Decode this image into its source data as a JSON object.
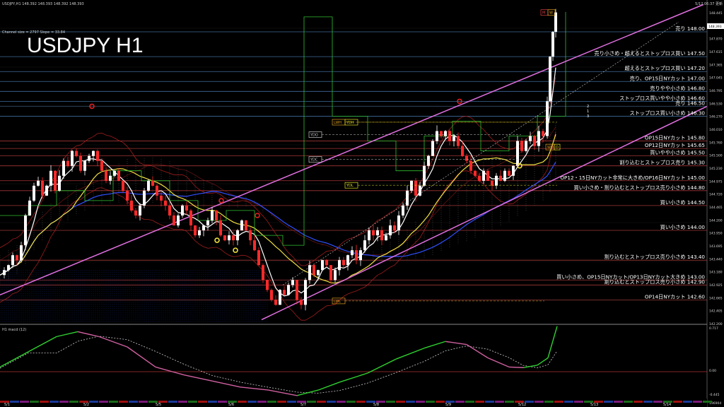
{
  "window": {
    "symbol_header": "USDJPY,H1  148.392 148.393 148.392 148.393",
    "time_header": "5/12 06:37 更新",
    "channel_info": "Channel size = 2797 Slope = 33.84",
    "big_title": "USDJPY H1",
    "macd_label": "H1 macd (12)"
  },
  "colors": {
    "bull": "#ffffff",
    "bear": "#ff2a2a",
    "channel": "#e070e0",
    "ma_fast": "#ffffff",
    "ma_mid": "#f0e040",
    "ma_slow": "#3050ff",
    "band": "#b02020",
    "green": "#30c030",
    "level_blue": "#4a7fb5",
    "level_red": "#c04040"
  },
  "price_axis": [
    "148.445",
    "148.180",
    "147.870",
    "147.615",
    "147.365",
    "147.045",
    "146.795",
    "146.530",
    "146.270",
    "146.010",
    "145.760",
    "145.500",
    "145.230",
    "144.975",
    "144.720",
    "144.465",
    "144.200",
    "143.950",
    "143.695",
    "143.440",
    "143.180",
    "142.925",
    "142.665",
    "142.405",
    "142.200"
  ],
  "price_tag": "148.393",
  "macd_axis": [
    "0.717",
    "0.00",
    "-0.445",
    "196904"
  ],
  "date_axis": [
    "5/1",
    "5/2",
    "5/5",
    "5/6",
    "5/7",
    "5/8",
    "5/9",
    "5/12",
    "5/13",
    "5/14"
  ],
  "levels": [
    {
      "text": "売り 148.00",
      "price": 148.0,
      "color": "#4a7fb5"
    },
    {
      "text": "売り小さめ・超えるとストップロス買い 147.50",
      "price": 147.5,
      "color": "#4a7fb5"
    },
    {
      "text": "超えるとストップロス買い 147.20",
      "price": 147.2,
      "color": "#4a7fb5"
    },
    {
      "text": "売り、OP15日NYカット 147.00",
      "price": 147.0,
      "color": "#4a7fb5"
    },
    {
      "text": "売りやや小さめ 146.80",
      "price": 146.8,
      "color": "#4a7fb5"
    },
    {
      "text": "ストップロス買いやや小さめ 146.60",
      "price": 146.6,
      "color": "#4a7fb5"
    },
    {
      "text": "売り 146.50",
      "price": 146.5,
      "color": "#4a7fb5"
    },
    {
      "text": "ストップロス買い小さめ 146.30",
      "price": 146.3,
      "color": "#4a7fb5"
    },
    {
      "text": "OP15日NYカット 145.80",
      "price": 145.8,
      "color": "#c04040"
    },
    {
      "text": "OP12日NYカット 145.65",
      "price": 145.65,
      "color": "#c04040"
    },
    {
      "text": "買いやや小さめ 145.50",
      "price": 145.5,
      "color": "#c04040"
    },
    {
      "text": "割り込むとストップロス売り 145.30",
      "price": 145.3,
      "color": "#c04040"
    },
    {
      "text": "OP12・15日NYカット非常に大きめ/OP16日NYカット 145.00",
      "price": 145.0,
      "color": "#c04040"
    },
    {
      "text": "買い小さめ・割り込むとストップロス売り小さめ 144.80",
      "price": 144.8,
      "color": "#c04040"
    },
    {
      "text": "買い小さめ 144.50",
      "price": 144.5,
      "color": "#c04040"
    },
    {
      "text": "買い小さめ 144.00",
      "price": 144.0,
      "color": "#c04040"
    },
    {
      "text": "割り込むとストップロス売り小さめ 143.40",
      "price": 143.4,
      "color": "#c04040"
    },
    {
      "text": "買い小さめ、OP15日NYカット/OP13日NYカット大きめ 143.00",
      "price": 143.0,
      "color": "#c04040"
    },
    {
      "text": "割り込むとストップロス売り小さめ 142.90",
      "price": 142.9,
      "color": "#c04040"
    },
    {
      "text": "OP14日NYカット 142.60",
      "price": 142.6,
      "color": "#c04040"
    }
  ],
  "boxes": [
    {
      "text": "YDO",
      "color": "#c8c8c8"
    },
    {
      "text": "YDC",
      "color": "#c8c8c8"
    },
    {
      "text": "LWH",
      "color": "#e0a020"
    },
    {
      "text": "YDH",
      "color": "#e0e020"
    },
    {
      "text": "YDL",
      "color": "#e0e020"
    },
    {
      "text": "LWL",
      "color": "#e0a020"
    },
    {
      "text": "WO",
      "color": "#e0a020"
    },
    {
      "text": "D",
      "color": "#e0e020"
    },
    {
      "text": "M",
      "color": "#e04040"
    },
    {
      "text": "W",
      "color": "#e0a020"
    }
  ],
  "channel_numbers": [
    "2",
    "1",
    "3"
  ],
  "channel": {
    "upper": [
      [
        0,
        142.7
      ],
      [
        995,
        148.55
      ]
    ],
    "lower": [
      [
        370,
        142.2
      ],
      [
        1000,
        146.5
      ]
    ]
  },
  "chart_data": {
    "type": "candlestick",
    "title": "USDJPY H1",
    "y_range": [
      142.15,
      148.47
    ],
    "x_labels": [
      "5/1",
      "5/2",
      "5/5",
      "5/6",
      "5/7",
      "5/8",
      "5/9",
      "5/12",
      "5/13",
      "5/14"
    ],
    "close_path": [
      [
        0,
        143.1
      ],
      [
        6,
        143.2
      ],
      [
        12,
        143.3
      ],
      [
        18,
        143.5
      ],
      [
        24,
        143.4
      ],
      [
        30,
        143.7
      ],
      [
        36,
        144.3
      ],
      [
        42,
        144.6
      ],
      [
        48,
        144.9
      ],
      [
        54,
        145.0
      ],
      [
        60,
        144.7
      ],
      [
        66,
        144.9
      ],
      [
        72,
        145.2
      ],
      [
        78,
        144.8
      ],
      [
        84,
        145.1
      ],
      [
        90,
        145.4
      ],
      [
        96,
        145.3
      ],
      [
        102,
        145.6
      ],
      [
        108,
        145.5
      ],
      [
        114,
        145.2
      ],
      [
        120,
        145.4
      ],
      [
        126,
        145.5
      ],
      [
        132,
        145.6
      ],
      [
        138,
        145.4
      ],
      [
        144,
        145.2
      ],
      [
        150,
        145.0
      ],
      [
        156,
        145.1
      ],
      [
        162,
        145.2
      ],
      [
        168,
        145.0
      ],
      [
        174,
        144.8
      ],
      [
        180,
        144.6
      ],
      [
        186,
        144.4
      ],
      [
        192,
        144.3
      ],
      [
        198,
        144.5
      ],
      [
        204,
        144.8
      ],
      [
        210,
        145.0
      ],
      [
        216,
        144.9
      ],
      [
        222,
        144.7
      ],
      [
        228,
        144.6
      ],
      [
        234,
        144.5
      ],
      [
        240,
        144.3
      ],
      [
        246,
        144.1
      ],
      [
        252,
        144.3
      ],
      [
        258,
        144.5
      ],
      [
        264,
        144.4
      ],
      [
        270,
        144.1
      ],
      [
        276,
        143.9
      ],
      [
        282,
        144.0
      ],
      [
        288,
        144.1
      ],
      [
        294,
        144.2
      ],
      [
        300,
        144.4
      ],
      [
        306,
        144.2
      ],
      [
        312,
        143.9
      ],
      [
        318,
        143.8
      ],
      [
        324,
        143.9
      ],
      [
        330,
        143.8
      ],
      [
        336,
        144.0
      ],
      [
        342,
        144.2
      ],
      [
        348,
        144.0
      ],
      [
        354,
        143.8
      ],
      [
        360,
        143.6
      ],
      [
        366,
        143.3
      ],
      [
        372,
        143.0
      ],
      [
        378,
        142.8
      ],
      [
        384,
        142.6
      ],
      [
        390,
        142.5
      ],
      [
        396,
        142.8
      ],
      [
        402,
        142.7
      ],
      [
        408,
        142.9
      ],
      [
        414,
        143.0
      ],
      [
        420,
        142.6
      ],
      [
        426,
        142.5
      ],
      [
        432,
        143.0
      ],
      [
        438,
        143.3
      ],
      [
        444,
        143.1
      ],
      [
        450,
        143.2
      ],
      [
        456,
        143.4
      ],
      [
        462,
        143.3
      ],
      [
        468,
        143.0
      ],
      [
        474,
        143.2
      ],
      [
        480,
        143.4
      ],
      [
        486,
        143.3
      ],
      [
        492,
        143.5
      ],
      [
        498,
        143.6
      ],
      [
        504,
        143.4
      ],
      [
        510,
        143.6
      ],
      [
        516,
        143.8
      ],
      [
        522,
        144.0
      ],
      [
        528,
        143.9
      ],
      [
        534,
        144.0
      ],
      [
        540,
        143.8
      ],
      [
        546,
        143.9
      ],
      [
        552,
        144.1
      ],
      [
        558,
        144.0
      ],
      [
        564,
        144.3
      ],
      [
        570,
        144.5
      ],
      [
        576,
        144.8
      ],
      [
        582,
        145.0
      ],
      [
        588,
        144.7
      ],
      [
        594,
        144.9
      ],
      [
        600,
        145.3
      ],
      [
        606,
        145.5
      ],
      [
        612,
        145.8
      ],
      [
        618,
        146.0
      ],
      [
        624,
        145.9
      ],
      [
        630,
        146.0
      ],
      [
        636,
        145.8
      ],
      [
        642,
        145.9
      ],
      [
        648,
        145.7
      ],
      [
        654,
        145.5
      ],
      [
        660,
        145.4
      ],
      [
        666,
        145.2
      ],
      [
        672,
        145.1
      ],
      [
        678,
        145.0
      ],
      [
        684,
        145.2
      ],
      [
        690,
        145.0
      ],
      [
        696,
        144.9
      ],
      [
        702,
        145.1
      ],
      [
        708,
        145.0
      ],
      [
        714,
        145.2
      ],
      [
        720,
        145.1
      ],
      [
        726,
        145.3
      ],
      [
        732,
        145.8
      ],
      [
        738,
        145.6
      ],
      [
        744,
        145.8
      ],
      [
        750,
        145.9
      ],
      [
        756,
        145.7
      ],
      [
        762,
        146.0
      ],
      [
        768,
        145.9
      ],
      [
        774,
        146.6
      ],
      [
        778,
        147.5
      ],
      [
        782,
        148.0
      ],
      [
        786,
        148.39
      ]
    ]
  }
}
